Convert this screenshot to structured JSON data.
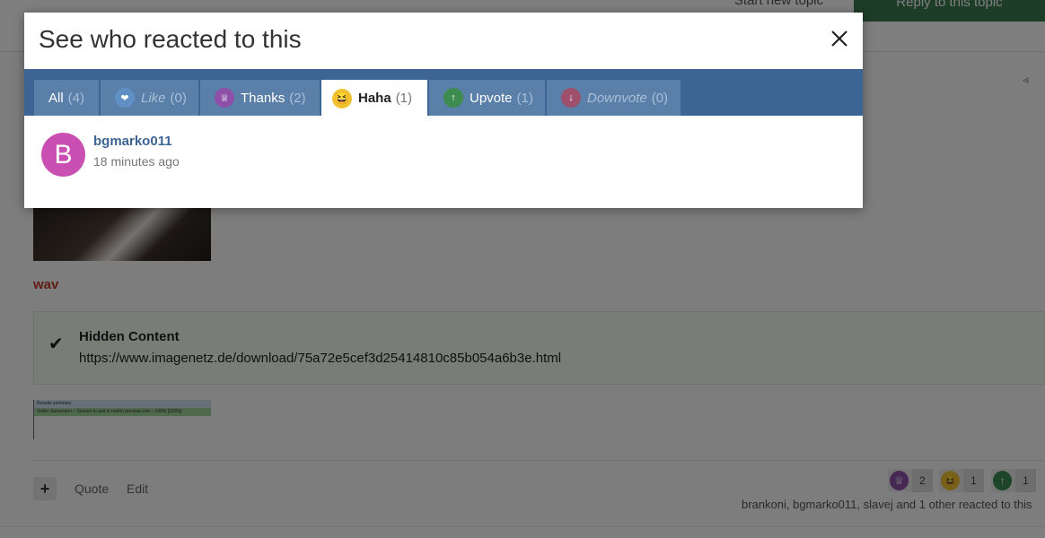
{
  "background": {
    "start_topic_label": "Start new topic",
    "reply_label": "Reply to this topic",
    "wav_label": "wav",
    "hidden_content": {
      "title": "Hidden Content",
      "link": "https://www.imagenetz.de/download/75a72e5cef3d25414810c85b054a6b3e.html"
    },
    "results_thumb": {
      "row1": "Results summary",
      "row2": "Softer Samandori – Senses to and in rastim preview.com – 100% [100%]"
    },
    "actions": {
      "plus_label": "+",
      "quote_label": "Quote",
      "edit_label": "Edit"
    },
    "reaction_pills": [
      {
        "icon": "trophy-icon",
        "count": "2",
        "color": "#8e4fa8"
      },
      {
        "icon": "laughing-face-icon",
        "count": "1",
        "color": "#f0c330"
      },
      {
        "icon": "arrow-up-icon",
        "count": "1",
        "color": "#3d8b4f"
      }
    ],
    "reaction_summary": "brankoni, bgmarko011, slavej and 1 other reacted to this"
  },
  "modal": {
    "title": "See who reacted to this",
    "close_icon": "close-icon",
    "tabs": [
      {
        "label": "All",
        "count": "(4)",
        "icon": "",
        "active": false,
        "faded": false
      },
      {
        "label": "Like",
        "count": "(0)",
        "icon": "heart-icon",
        "color": "#3f78b8",
        "active": false,
        "faded": true
      },
      {
        "label": "Thanks",
        "count": "(2)",
        "icon": "trophy-icon",
        "color": "#8e4fa8",
        "active": false,
        "faded": false
      },
      {
        "label": "Haha",
        "count": "(1)",
        "icon": "laughing-face-icon",
        "color": "#f0c330",
        "active": true,
        "faded": false
      },
      {
        "label": "Upvote",
        "count": "(1)",
        "icon": "arrow-up-icon",
        "color": "#3d8b4f",
        "active": false,
        "faded": false
      },
      {
        "label": "Downvote",
        "count": "(0)",
        "icon": "arrow-down-icon",
        "color": "#9e3f5c",
        "active": false,
        "faded": true
      }
    ],
    "users": [
      {
        "avatar_letter": "B",
        "avatar_color": "#c94fb2",
        "name": "bgmarko011",
        "time": "18 minutes ago"
      }
    ]
  }
}
